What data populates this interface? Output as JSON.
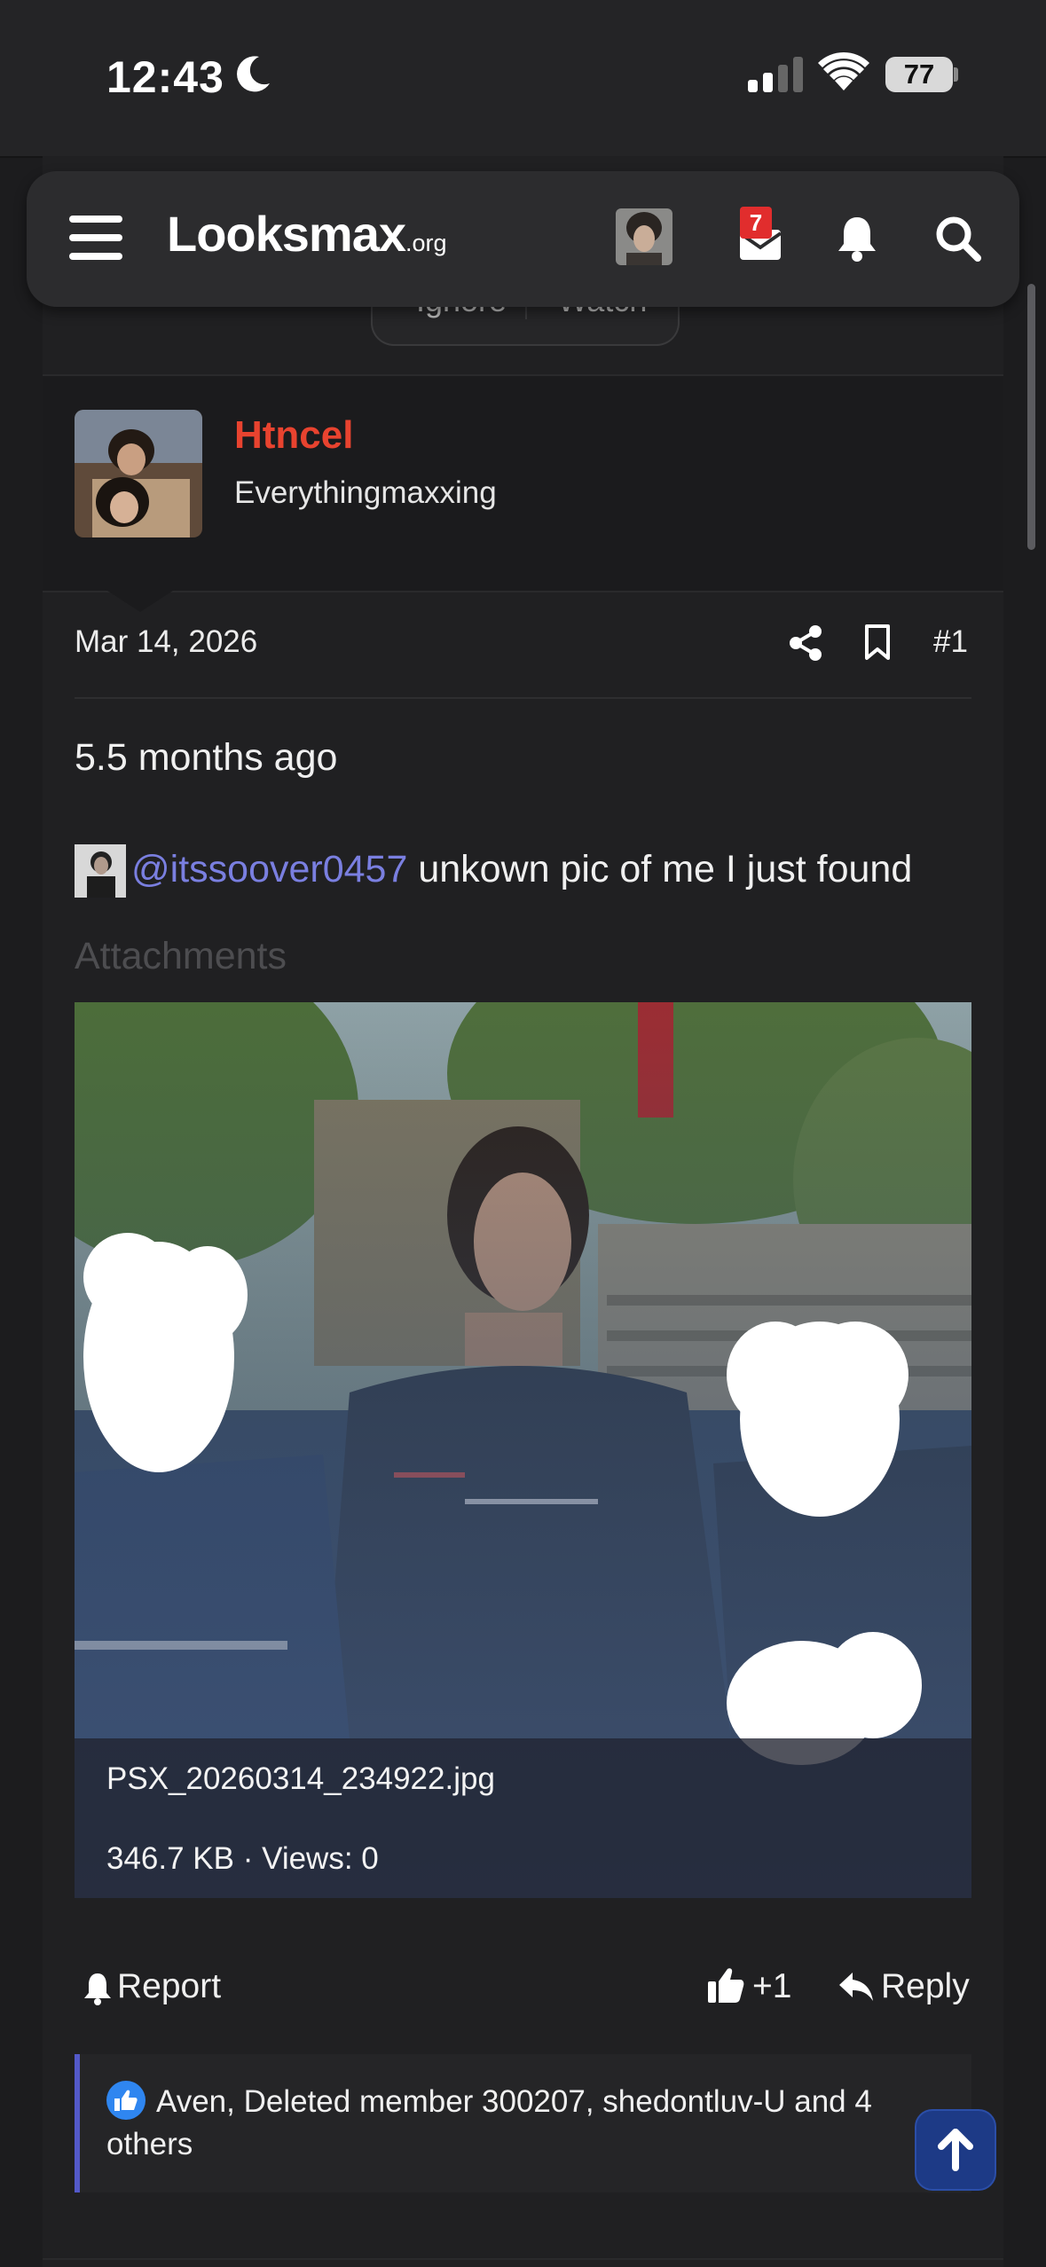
{
  "status_bar": {
    "time": "12:43",
    "battery": "77"
  },
  "nav": {
    "logo_main": "Looksmax",
    "logo_suffix": ".org",
    "mail_badge_count": "7",
    "icons": [
      "menu-icon",
      "avatar",
      "mail-icon",
      "bell-icon",
      "search-icon"
    ]
  },
  "tabs": {
    "ignore": "Ignore",
    "watch": "Watch"
  },
  "user": {
    "name": "Htncel",
    "title": "Everythingmaxxing",
    "name_color": "#e8432f"
  },
  "post": {
    "date": "Mar 14, 2026",
    "number": "#1",
    "line1": "5.5 months ago",
    "mention": "@itssoover0457",
    "line2_rest": " unkown pic of me I just found",
    "attachments_label": "Attachments"
  },
  "attachment": {
    "filename": "PSX_20260314_234922.jpg",
    "meta": "346.7 KB · Views: 0"
  },
  "actions": {
    "report": "Report",
    "like_count": "+1",
    "reply": "Reply"
  },
  "reactions": {
    "text": "Aven, Deleted member 300207, shedontluv-U and 4 others"
  },
  "colors": {
    "accent": "#5359c9",
    "mention": "#7a7fe0",
    "badge": "#e12d2d"
  }
}
